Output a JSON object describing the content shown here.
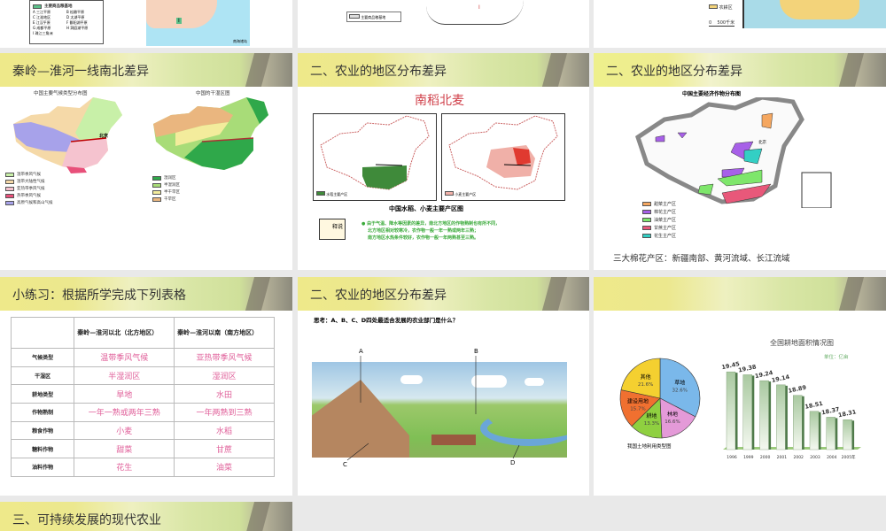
{
  "slides": {
    "s1": {
      "legend_title": "主要商品粮基地",
      "legend_items": [
        "A 三江平原",
        "B 松嫩平原",
        "C 江淮地区",
        "D 太湖平原",
        "E 江汉平原",
        "F 鄱阳湖平原",
        "G 成都平原",
        "H 洞庭湖平原",
        "I 珠江三角洲"
      ],
      "map_label": "I",
      "inset": "南海诸岛"
    },
    "s2": {
      "legend": "主要商品粮基地",
      "map_label": "I"
    },
    "s3": {
      "legend": "农耕区",
      "scale": "0    500千米"
    },
    "s4": {
      "title": "秦岭—淮河一线南北差异",
      "map1_caption": "中国主要气候类型分布图",
      "map2_caption": "中国的干湿区图",
      "city": "北京",
      "legend1": [
        "温带季风气候",
        "温带大陆性气候",
        "亚热带季风气候",
        "热带季风气候",
        "高原气候和高山气候"
      ],
      "legend2": [
        "湿润区",
        "半湿润区",
        "半干旱区",
        "干旱区"
      ]
    },
    "s5": {
      "title": "二、农业的地区分布差异",
      "heading": "南稻北麦",
      "legend1": "水稻主要产区",
      "legend2": "小麦主要产区",
      "caption": "中国水稻、小麦主要产区图",
      "icon_text": "释说",
      "notes": [
        "● 由于气温、降水等因素的差异，南北方地区的作物熟制也有所不同，",
        "北方地区相对较寒冷，农作物一般一年一熟或两年三熟；",
        "南方地区水热条件较好，农作物一般一年两熟甚至三熟。"
      ]
    },
    "s6": {
      "title": "二、农业的地区分布差异",
      "caption": "中国主要经济作物分布图",
      "city": "北京",
      "legend": [
        "甜菜主产区",
        "棉花主产区",
        "油菜主产区",
        "甘蔗主产区",
        "花生主产区"
      ],
      "note": "三大棉花产区：新疆南部、黄河流域、长江流域"
    },
    "s7": {
      "title": "小练习：根据所学完成下列表格",
      "headers": [
        "",
        "秦岭—淮河以北（北方地区）",
        "秦岭—淮河以南（南方地区）"
      ],
      "rows": [
        [
          "气候类型",
          "温带季风气候",
          "亚热带季风气候"
        ],
        [
          "干湿区",
          "半湿润区",
          "湿润区"
        ],
        [
          "耕地类型",
          "旱地",
          "水田"
        ],
        [
          "作物熟制",
          "一年一熟或两年三熟",
          "一年两熟到三熟"
        ],
        [
          "粮食作物",
          "小麦",
          "水稻"
        ],
        [
          "糖料作物",
          "甜菜",
          "甘蔗"
        ],
        [
          "油料作物",
          "花生",
          "油菜"
        ]
      ]
    },
    "s8": {
      "title": "二、农业的地区分布差异",
      "question": "思考：A、B、C、D四处最适合发展的农业部门是什么？",
      "labels": [
        "A",
        "B",
        "C",
        "D"
      ]
    },
    "s10": {
      "title": "三、可持续发展的现代农业"
    }
  },
  "colors": {
    "climate": [
      "#c8f0a8",
      "#f5d9a8",
      "#f5c3cf",
      "#e8507a",
      "#a7a2ea"
    ],
    "drywet": [
      "#2fa84a",
      "#a8dc78",
      "#f3ec9c",
      "#eab67f"
    ],
    "crops": [
      "#f5a760",
      "#a760e8",
      "#7ee66b",
      "#e8587a",
      "#33cfc4"
    ]
  },
  "chart_data": [
    {
      "type": "pie",
      "title": "我国土地利用类型图",
      "categories": [
        "草地",
        "林地",
        "耕地",
        "建设用地",
        "其他"
      ],
      "values": [
        32.6,
        16.6,
        13.3,
        15.7,
        21.6
      ],
      "labels": [
        "32.6%",
        "16.6%",
        "13.3%",
        "15.7%",
        "21.6%"
      ],
      "colors": [
        "#7ab8ea",
        "#e49ad8",
        "#8fd040",
        "#f07030",
        "#f4d030"
      ]
    },
    {
      "type": "bar",
      "title": "全国耕地面积情况图",
      "unit": "单位：亿亩",
      "categories": [
        "1996",
        "1999",
        "2000",
        "2001",
        "2002",
        "2003",
        "2004",
        "2005年"
      ],
      "values": [
        19.45,
        19.38,
        19.24,
        19.14,
        18.89,
        18.51,
        18.37,
        18.31
      ],
      "ylim": [
        17.6,
        19.6
      ]
    }
  ]
}
